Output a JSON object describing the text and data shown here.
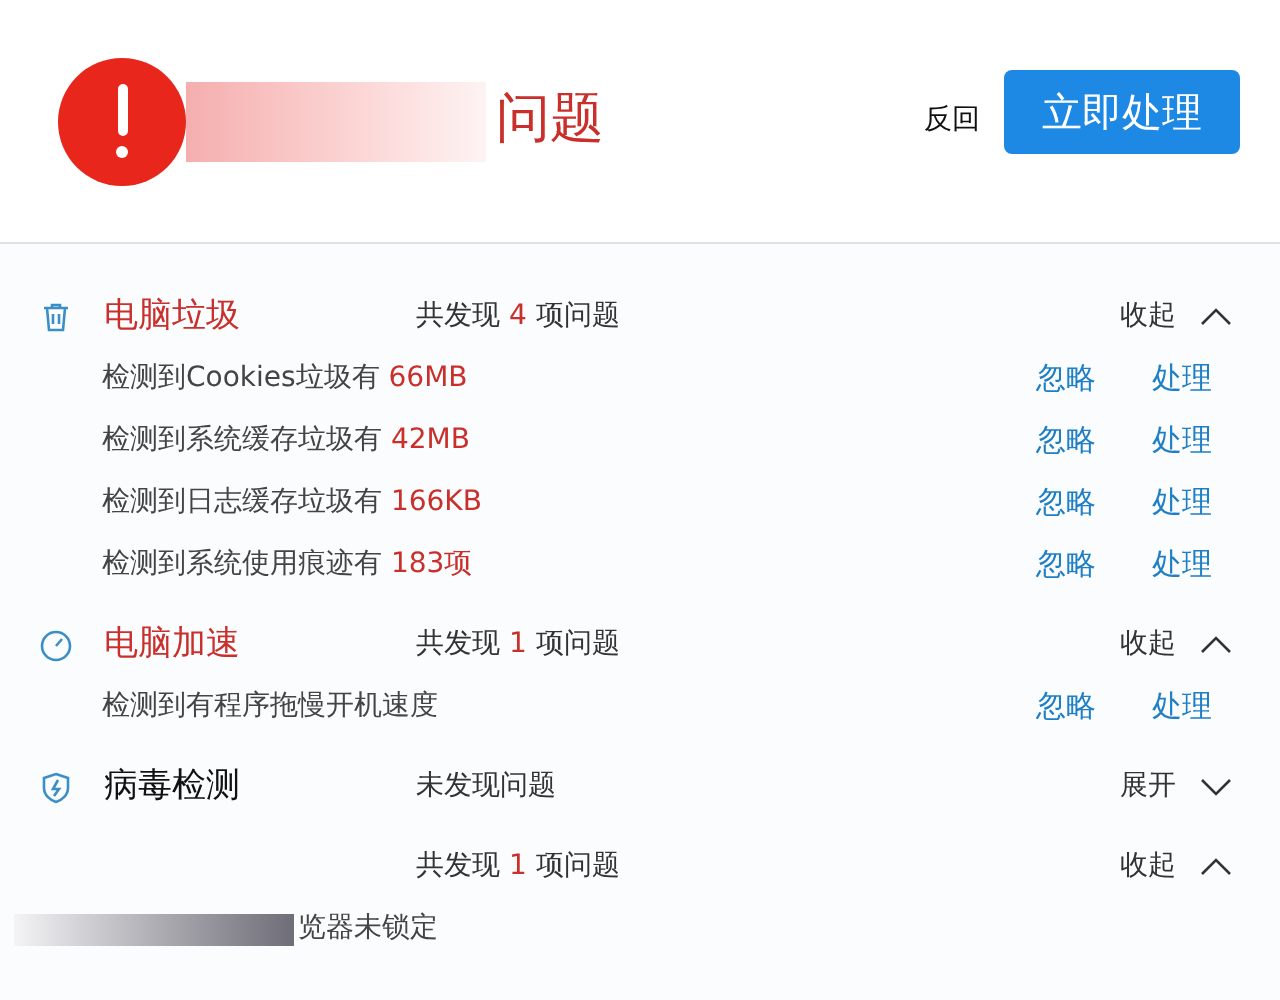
{
  "header": {
    "title": "问题",
    "back": "反回",
    "action": "立即处理"
  },
  "sections": [
    {
      "kind": "trash",
      "title": "电脑垃圾",
      "has_issues": true,
      "summary_prefix": "共发现",
      "count": "4",
      "summary_suffix": "项问题",
      "toggle": "收起",
      "expanded": true,
      "items": [
        {
          "text": "检测到Cookies垃圾有",
          "value": "66MB",
          "ignore": "忽略",
          "fix": "处理"
        },
        {
          "text": "检测到系统缓存垃圾有",
          "value": "42MB",
          "ignore": "忽略",
          "fix": "处理"
        },
        {
          "text": "检测到日志缓存垃圾有",
          "value": "166KB",
          "ignore": "忽略",
          "fix": "处理"
        },
        {
          "text": "检测到系统使用痕迹有",
          "value": "183项",
          "ignore": "忽略",
          "fix": "处理"
        }
      ]
    },
    {
      "kind": "gauge",
      "title": "电脑加速",
      "has_issues": true,
      "summary_prefix": "共发现",
      "count": "1",
      "summary_suffix": "项问题",
      "toggle": "收起",
      "expanded": true,
      "items": [
        {
          "text": "检测到有程序拖慢开机速度",
          "ignore": "忽略",
          "fix": "处理"
        }
      ]
    },
    {
      "kind": "shield",
      "title": "病毒检测",
      "has_issues": false,
      "summary_prefix": "未发现问题",
      "toggle": "展开",
      "expanded": false
    },
    {
      "summary_prefix": "共发现",
      "count": "1",
      "summary_suffix": "项问题",
      "toggle": "收起",
      "expanded": true,
      "items": [
        {
          "redacted": true,
          "text": "览器未锁定"
        }
      ]
    }
  ]
}
